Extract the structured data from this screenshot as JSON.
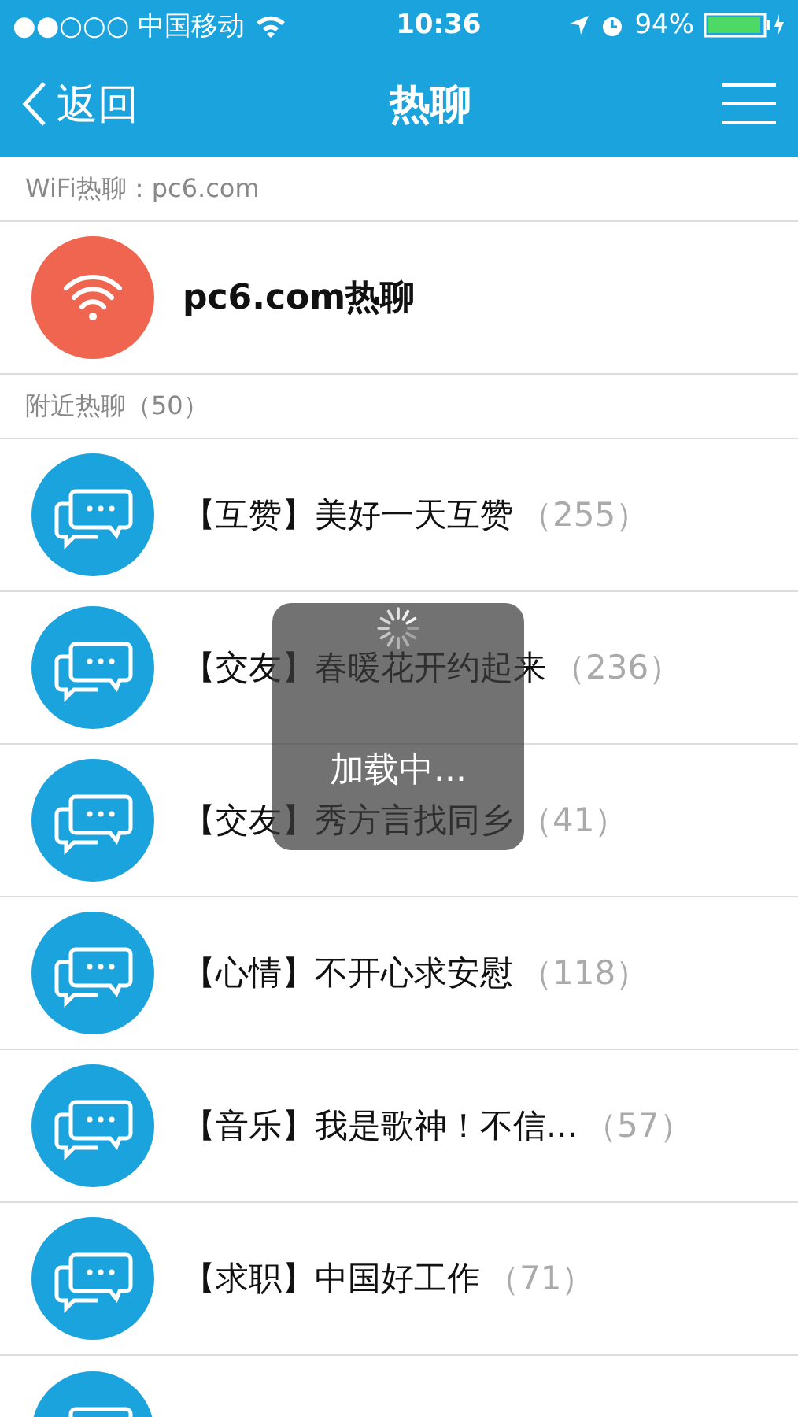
{
  "status_bar": {
    "carrier": "●●○○○ 中国移动",
    "time": "10:36",
    "battery": "94%"
  },
  "nav": {
    "back": "返回",
    "title": "热聊"
  },
  "wifi_section": {
    "header": "WiFi热聊：pc6.com",
    "item": {
      "name": "pc6.com热聊"
    }
  },
  "nearby_section": {
    "header": "附近热聊（50）",
    "rooms": [
      {
        "kind": "room",
        "title": "【互赞】美好一天互赞",
        "count": "（255）"
      },
      {
        "kind": "room",
        "title": "【交友】春暖花开约起来",
        "count": "（236）"
      },
      {
        "kind": "room",
        "title": "【交友】秀方言找同乡",
        "count": "（41）"
      },
      {
        "kind": "room",
        "title": "【心情】不开心求安慰",
        "count": "（118）"
      },
      {
        "kind": "room",
        "title": "【音乐】我是歌神！不信...",
        "count": "（57）"
      },
      {
        "kind": "room",
        "title": "【求职】中国好工作",
        "count": "（71）"
      },
      {
        "kind": "cut"
      }
    ]
  },
  "loading": {
    "text": "加载中..."
  }
}
